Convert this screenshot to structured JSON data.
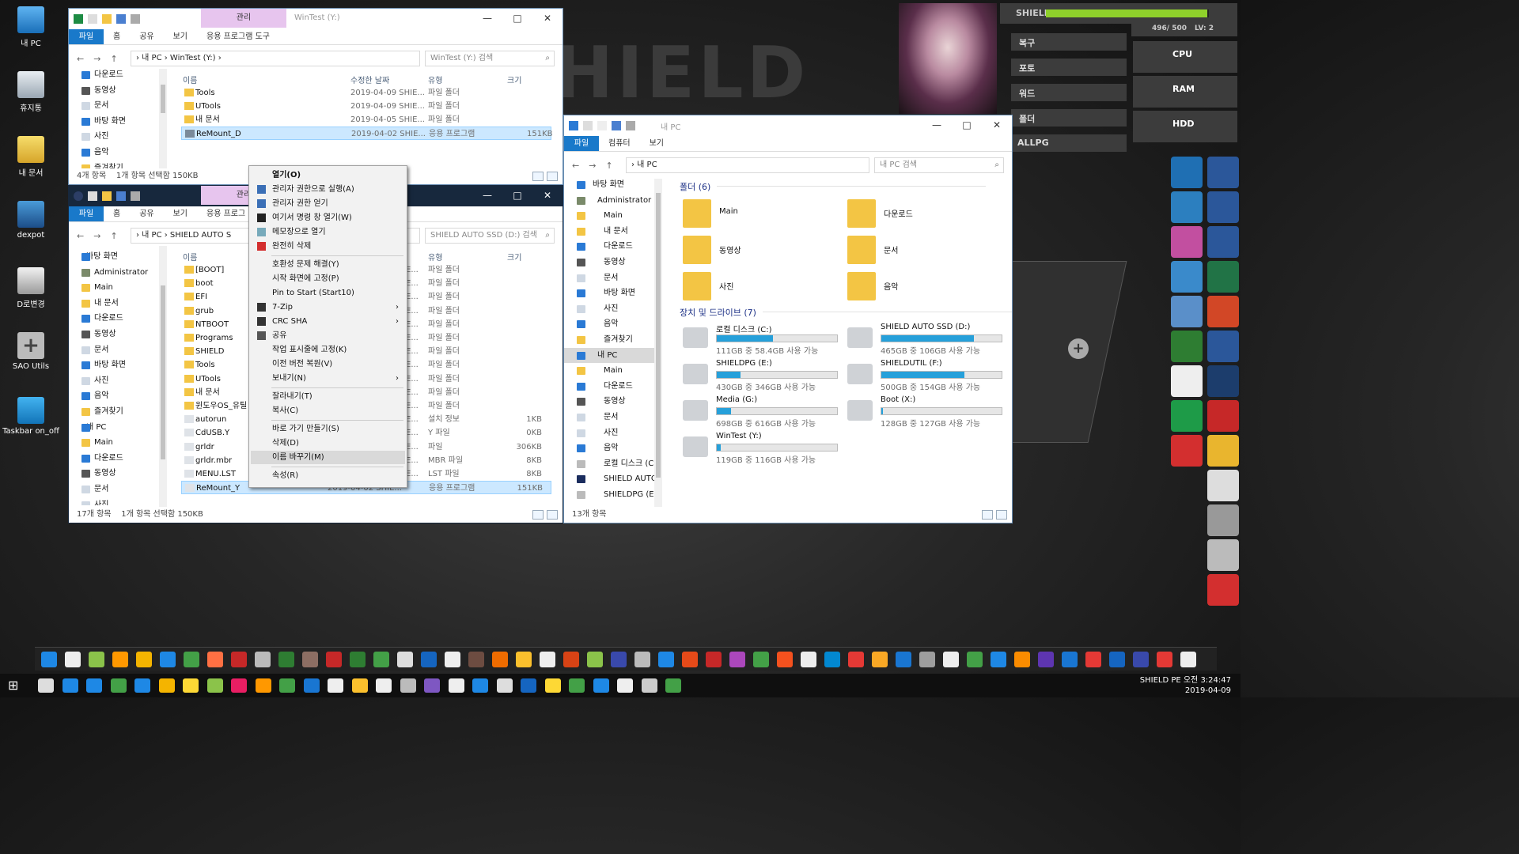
{
  "desktop_icons": [
    {
      "label": "내 PC"
    },
    {
      "label": "휴지통"
    },
    {
      "label": "내 문서"
    },
    {
      "label": "dexpot"
    },
    {
      "label": "D로변경"
    },
    {
      "label": "SAO Utils"
    },
    {
      "label": "Taskbar on_off"
    }
  ],
  "wintest": {
    "ctx_tab": "관리",
    "title": "WinTest (Y:)",
    "tabs": [
      "파일",
      "홈",
      "공유",
      "보기",
      "응용 프로그램 도구"
    ],
    "path": "› 내 PC › WinTest (Y:) ›",
    "search": "WinTest (Y:) 검색",
    "sidebar": [
      "다운로드",
      "동영상",
      "문서",
      "바탕 화면",
      "사진",
      "음악",
      "즐겨찾기"
    ],
    "headers": [
      "이름",
      "수정한 날짜",
      "유형",
      "크기"
    ],
    "rows": [
      {
        "name": "Tools",
        "date": "2019-04-09 SHIE...",
        "type": "파일 폴더",
        "size": ""
      },
      {
        "name": "UTools",
        "date": "2019-04-09 SHIE...",
        "type": "파일 폴더",
        "size": ""
      },
      {
        "name": "내 문서",
        "date": "2019-04-05 SHIE...",
        "type": "파일 폴더",
        "size": ""
      },
      {
        "name": "ReMount_D",
        "date": "2019-04-02 SHIE...",
        "type": "응용 프로그램",
        "size": "151KB"
      }
    ],
    "status_count": "4개 항목",
    "status_sel": "1개 항목 선택함 150KB"
  },
  "shield": {
    "ctx_tab": "관리",
    "tabs": [
      "파일",
      "홈",
      "공유",
      "보기",
      "응용 프로그"
    ],
    "path": "› 내 PC › SHIELD AUTO S",
    "search": "SHIELD AUTO SSD (D:) 검색",
    "sidebar": [
      "바탕 화면",
      "Administrator",
      "Main",
      "내 문서",
      "다운로드",
      "동영상",
      "문서",
      "바탕 화면",
      "사진",
      "음악",
      "즐겨찾기",
      "내 PC",
      "Main",
      "다운로드",
      "동영상",
      "문서",
      "사진"
    ],
    "headers": [
      "이름",
      "유형",
      "크기"
    ],
    "rows": [
      {
        "name": "[BOOT]",
        "type": "파일 폴더",
        "size": ""
      },
      {
        "name": "boot",
        "type": "파일 폴더",
        "size": ""
      },
      {
        "name": "EFI",
        "type": "파일 폴더",
        "size": ""
      },
      {
        "name": "grub",
        "type": "파일 폴더",
        "size": ""
      },
      {
        "name": "NTBOOT",
        "type": "파일 폴더",
        "size": ""
      },
      {
        "name": "Programs",
        "type": "파일 폴더",
        "size": ""
      },
      {
        "name": "SHIELD",
        "type": "파일 폴더",
        "size": ""
      },
      {
        "name": "Tools",
        "type": "파일 폴더",
        "size": ""
      },
      {
        "name": "UTools",
        "type": "파일 폴더",
        "size": ""
      },
      {
        "name": "내 문서",
        "type": "파일 폴더",
        "size": ""
      },
      {
        "name": "윈도우OS_유틸",
        "type": "파일 폴더",
        "size": ""
      },
      {
        "name": "autorun",
        "type": "설치 정보",
        "size": "1KB"
      },
      {
        "name": "CdUSB.Y",
        "type": "Y 파일",
        "size": "0KB"
      },
      {
        "name": "grldr",
        "type": "파일",
        "size": "306KB"
      },
      {
        "name": "grldr.mbr",
        "type": "MBR 파일",
        "size": "8KB"
      },
      {
        "name": "MENU.LST",
        "type": "LST 파일",
        "size": "8KB"
      },
      {
        "name": "ReMount_Y",
        "date": "2019-04-02 SHIE...",
        "type": "응용 프로그램",
        "size": "151KB"
      }
    ],
    "status_count": "17개 항목",
    "status_sel": "1개 항목 선택함 150KB"
  },
  "context_menu": [
    {
      "label": "열기(O)",
      "bold": true
    },
    {
      "label": "관리자 권한으로 실행(A)"
    },
    {
      "label": "관리자 권한 얻기"
    },
    {
      "label": "여기서 명령 창 열기(W)"
    },
    {
      "label": "메모장으로 열기"
    },
    {
      "label": "완전히 삭제"
    },
    {
      "label": "호환성 문제 해결(Y)"
    },
    {
      "label": "시작 화면에 고정(P)"
    },
    {
      "label": "Pin to Start (Start10)"
    },
    {
      "label": "7-Zip",
      "submenu": true
    },
    {
      "label": "CRC SHA",
      "submenu": true
    },
    {
      "label": "공유"
    },
    {
      "label": "작업 표시줄에 고정(K)"
    },
    {
      "label": "이전 버전 복원(V)"
    },
    {
      "label": "보내기(N)",
      "submenu": true
    },
    {
      "label": "잘라내기(T)"
    },
    {
      "label": "복사(C)"
    },
    {
      "label": "바로 가기 만들기(S)"
    },
    {
      "label": "삭제(D)"
    },
    {
      "label": "이름 바꾸기(M)"
    },
    {
      "label": "속성(R)"
    }
  ],
  "mypc": {
    "title": "내 PC",
    "tabs": [
      "파일",
      "컴퓨터",
      "보기"
    ],
    "path": "› 내 PC",
    "search": "내 PC 검색",
    "sidebar": [
      "바탕 화면",
      "Administrator",
      "Main",
      "내 문서",
      "다운로드",
      "동영상",
      "문서",
      "바탕 화면",
      "사진",
      "음악",
      "즐겨찾기",
      "내 PC",
      "Main",
      "다운로드",
      "동영상",
      "문서",
      "사진",
      "음악",
      "로컬 디스크 (C",
      "SHIELD AUTO",
      "SHIELDPG (E:)"
    ],
    "folders_header": "폴더 (6)",
    "folders": [
      "Main",
      "다운로드",
      "동영상",
      "문서",
      "사진",
      "음악"
    ],
    "drives_header": "장치 및 드라이브 (7)",
    "drives": [
      {
        "name": "로컬 디스크 (C:)",
        "free": "111GB 중 58.4GB 사용 가능",
        "used": 0.47
      },
      {
        "name": "SHIELD AUTO SSD (D:)",
        "free": "465GB 중 106GB 사용 가능",
        "used": 0.77
      },
      {
        "name": "SHIELDPG (E:)",
        "free": "430GB 중 346GB 사용 가능",
        "used": 0.2
      },
      {
        "name": "SHIELDUTIL (F:)",
        "free": "500GB 중 154GB 사용 가능",
        "used": 0.69
      },
      {
        "name": "Media (G:)",
        "free": "698GB 중 616GB 사용 가능",
        "used": 0.12
      },
      {
        "name": "Boot (X:)",
        "free": "128GB 중 127GB 사용 가능",
        "used": 0.01
      },
      {
        "name": "WinTest (Y:)",
        "free": "119GB 중 116GB 사용 가능",
        "used": 0.03
      }
    ],
    "status": "13개 항목"
  },
  "hud": {
    "name": "SHIELD",
    "hp": "496/ 500",
    "lv": "LV: 2",
    "menu": [
      "복구",
      "포토",
      "워드",
      "폴더",
      "ALLPG"
    ],
    "meters": [
      "CPU",
      "RAM",
      "HDD"
    ]
  },
  "clock": {
    "line1": "SHIELD PE 오전 3:24:47",
    "line2": "2019-04-09"
  },
  "colors": {
    "accent": "#1979ca",
    "selection": "#cce8ff",
    "drive_bar": "#26a0da",
    "context_tab": "#e7c5ee",
    "hp_bar": "#8fd12b"
  }
}
